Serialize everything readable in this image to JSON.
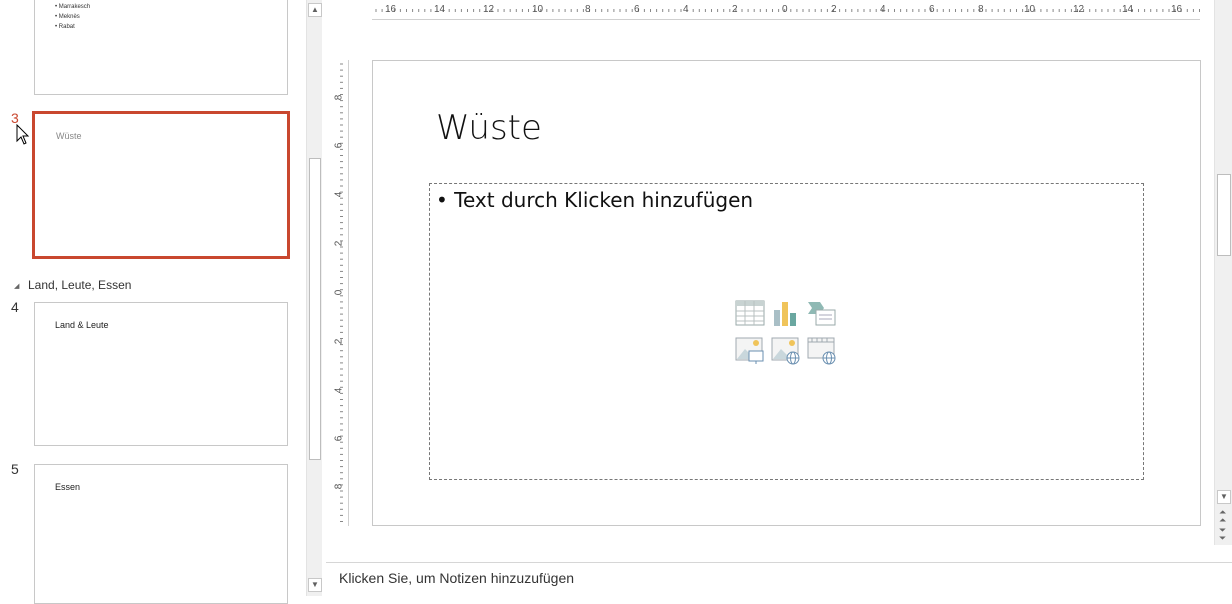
{
  "thumbnails": {
    "slide2": {
      "bullets": [
        "Marrakesch",
        "Meknès",
        "Rabat"
      ]
    },
    "slide3": {
      "number": "3",
      "title": "Wüste",
      "selected": true
    },
    "section": {
      "label": "Land, Leute, Essen"
    },
    "slide4": {
      "number": "4",
      "title": "Land & Leute"
    },
    "slide5": {
      "number": "5",
      "title": "Essen"
    }
  },
  "ruler": {
    "horizontal": [
      "16",
      "14",
      "12",
      "10",
      "8",
      "6",
      "4",
      "2",
      "0",
      "2",
      "4",
      "6",
      "8",
      "10",
      "12",
      "14",
      "16"
    ],
    "vertical": [
      "8",
      "6",
      "4",
      "2",
      "0",
      "2",
      "4",
      "6",
      "8"
    ]
  },
  "slide": {
    "title": "Wüste",
    "placeholder_text": "• Text durch Klicken hinzufügen",
    "insert_icons": [
      "table-icon",
      "chart-icon",
      "smartart-icon",
      "picture-icon",
      "online-picture-icon",
      "video-icon"
    ]
  },
  "notes": {
    "placeholder": "Klicken Sie, um Notizen hinzuzufügen"
  },
  "colors": {
    "selection": "#c9472f",
    "accent_teal": "#6aa7a0",
    "accent_gold": "#f0c45a"
  }
}
